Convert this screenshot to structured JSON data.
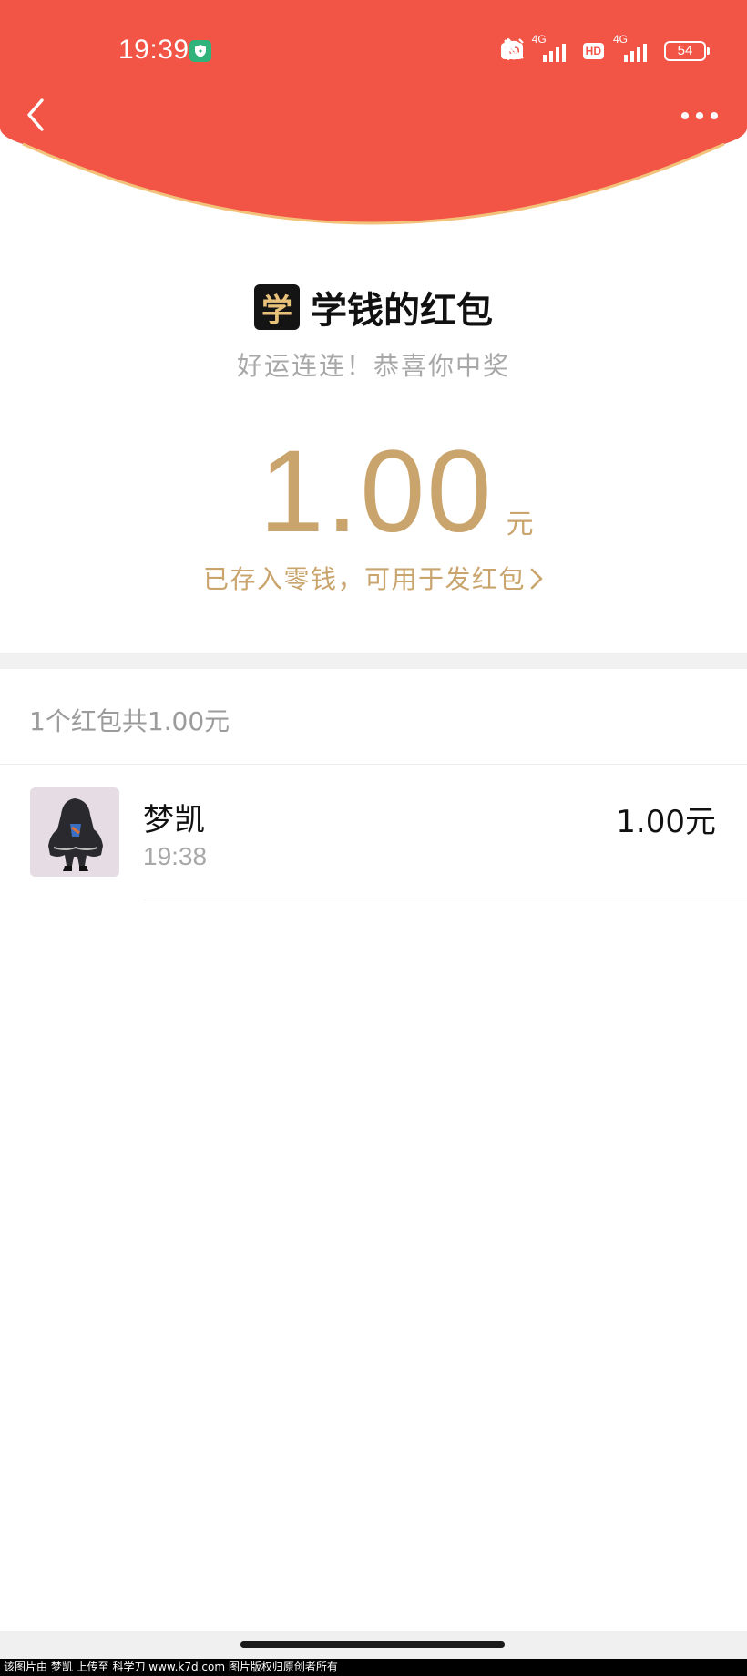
{
  "status_bar": {
    "time": "19:39",
    "hd_badge_1": "HD",
    "hd_badge_2": "HD",
    "network_1": "4G",
    "network_2": "4G",
    "battery": "54"
  },
  "colors": {
    "header_red": "#F25546",
    "gold": "#C9A46C",
    "rim": "#F3C27A"
  },
  "icons": [
    "back-arrow-icon",
    "more-icon",
    "bluetooth-icon",
    "mute-bell-icon",
    "alarm-icon",
    "signal-icon",
    "battery-icon",
    "chevron-right-icon"
  ],
  "red_packet": {
    "sender_avatar_char": "学",
    "title": "学钱的红包",
    "greeting": "好运连连！恭喜你中奖",
    "amount": "1.00",
    "unit": "元",
    "saved_text": "已存入零钱，可用于发红包"
  },
  "summary": "1个红包共1.00元",
  "records": [
    {
      "name": "梦凯",
      "time": "19:38",
      "amount": "1.00元"
    }
  ],
  "watermark": "该图片由 梦凯 上传至 科学刀 www.k7d.com 图片版权归原创者所有"
}
